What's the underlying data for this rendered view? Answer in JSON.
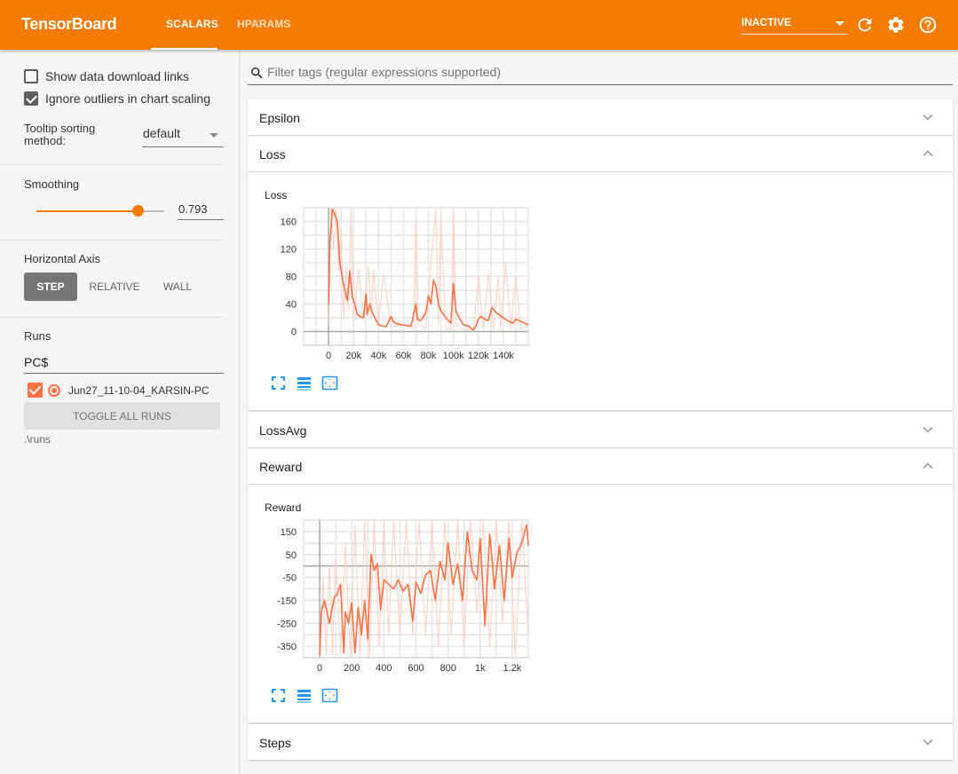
{
  "header": {
    "brand": "TensorBoard",
    "tabs": [
      {
        "label": "SCALARS",
        "active": true
      },
      {
        "label": "HPARAMS",
        "active": false
      }
    ],
    "run_status": "INACTIVE",
    "icons": [
      "refresh-icon",
      "settings-icon",
      "help-icon"
    ],
    "accent_color": "#f57c00"
  },
  "sidebar": {
    "show_download_links": {
      "label": "Show data download links",
      "checked": false
    },
    "ignore_outliers": {
      "label": "Ignore outliers in chart scaling",
      "checked": true
    },
    "tooltip_sorting": {
      "label": "Tooltip sorting method:",
      "value": "default"
    },
    "smoothing": {
      "label": "Smoothing",
      "value": "0.793",
      "fraction": 0.793
    },
    "horizontal_axis": {
      "label": "Horizontal Axis",
      "options": [
        "STEP",
        "RELATIVE",
        "WALL"
      ],
      "selected": "STEP"
    },
    "runs": {
      "label": "Runs",
      "filter_value": "PC$",
      "items": [
        {
          "name": "Jun27_11-10-04_KARSIN-PC",
          "checked": true,
          "color": "#ff7043"
        }
      ],
      "toggle_all_label": "TOGGLE ALL RUNS",
      "logdir": ".\\runs"
    }
  },
  "main": {
    "search_placeholder": "Filter tags (regular expressions supported)",
    "panes": [
      {
        "title": "Epsilon",
        "expanded": false
      },
      {
        "title": "Loss",
        "expanded": true
      },
      {
        "title": "LossAvg",
        "expanded": false
      },
      {
        "title": "Reward",
        "expanded": true
      },
      {
        "title": "Steps",
        "expanded": false
      }
    ],
    "chart_tool_icons": [
      "fit-to-screen-icon",
      "toggle-log-scale-icon",
      "fit-domain-icon"
    ]
  },
  "chart_data": [
    {
      "type": "line",
      "title": "Loss",
      "xlabel": "",
      "ylabel": "",
      "x_ticks": [
        "0",
        "20k",
        "40k",
        "60k",
        "80k",
        "100k",
        "120k",
        "140k"
      ],
      "y_ticks": [
        "0",
        "40",
        "80",
        "120",
        "160"
      ],
      "xlim": [
        -20000,
        160000
      ],
      "ylim": [
        -20,
        180
      ],
      "grid": true,
      "series": [
        {
          "name": "Jun27_11-10-04_KARSIN-PC (smoothed)",
          "x": [
            0,
            1000,
            2000,
            3000,
            5000,
            7000,
            9000,
            11000,
            13000,
            15000,
            17000,
            19000,
            21000,
            23000,
            25000,
            28000,
            30000,
            31000,
            33000,
            35000,
            37000,
            40000,
            43000,
            46000,
            50000,
            52000,
            54000,
            58000,
            62000,
            66000,
            70000,
            71000,
            74000,
            78000,
            80000,
            82000,
            84000,
            86000,
            88000,
            90000,
            94000,
            98000,
            100000,
            102000,
            104000,
            108000,
            112000,
            116000,
            118000,
            120000,
            122000,
            125000,
            128000,
            131000,
            134000,
            137000,
            140000,
            144000,
            148000,
            150000,
            154000,
            157000,
            160000
          ],
          "y": [
            40,
            130,
            150,
            178,
            170,
            160,
            100,
            78,
            60,
            45,
            88,
            50,
            40,
            25,
            22,
            20,
            55,
            25,
            40,
            28,
            20,
            10,
            8,
            7,
            22,
            14,
            12,
            10,
            9,
            8,
            40,
            18,
            16,
            28,
            52,
            40,
            75,
            65,
            40,
            30,
            20,
            12,
            70,
            30,
            22,
            10,
            8,
            2,
            8,
            18,
            22,
            18,
            16,
            35,
            28,
            24,
            20,
            15,
            12,
            18,
            15,
            12,
            10
          ]
        },
        {
          "name": "Jun27_11-10-04_KARSIN-PC (raw)",
          "x": [
            0,
            2000,
            4000,
            6000,
            8000,
            10000,
            12000,
            14000,
            16000,
            18000,
            20000,
            24000,
            28000,
            32000,
            34000,
            36000,
            40000,
            44000,
            50000,
            56000,
            62000,
            68000,
            70000,
            72000,
            78000,
            82000,
            86000,
            88000,
            90000,
            94000,
            98000,
            100000,
            102000,
            106000,
            110000,
            116000,
            120000,
            124000,
            128000,
            132000,
            136000,
            138000,
            142000,
            146000,
            150000,
            154000,
            158000,
            160000
          ],
          "y": [
            10,
            178,
            120,
            178,
            90,
            150,
            20,
            95,
            30,
            178,
            15,
            90,
            15,
            95,
            20,
            90,
            8,
            85,
            6,
            10,
            8,
            5,
            165,
            10,
            5,
            100,
            178,
            10,
            165,
            5,
            3,
            178,
            10,
            5,
            3,
            2,
            80,
            3,
            85,
            3,
            80,
            3,
            100,
            3,
            82,
            3,
            5,
            15
          ]
        }
      ]
    },
    {
      "type": "line",
      "title": "Reward",
      "xlabel": "",
      "ylabel": "",
      "x_ticks": [
        "0",
        "200",
        "400",
        "600",
        "800",
        "1k",
        "1.2k"
      ],
      "y_ticks": [
        "150",
        "50",
        "-50",
        "-150",
        "-250",
        "-350"
      ],
      "xlim": [
        -100,
        1300
      ],
      "ylim": [
        -400,
        200
      ],
      "grid": true,
      "series": [
        {
          "name": "Jun27_11-10-04_KARSIN-PC (smoothed)",
          "x": [
            0,
            10,
            30,
            60,
            90,
            110,
            130,
            150,
            160,
            180,
            200,
            220,
            240,
            260,
            280,
            300,
            320,
            340,
            360,
            380,
            400,
            430,
            460,
            490,
            520,
            550,
            580,
            600,
            630,
            660,
            690,
            720,
            750,
            780,
            800,
            830,
            860,
            890,
            920,
            950,
            980,
            1000,
            1030,
            1060,
            1090,
            1120,
            1150,
            1180,
            1200,
            1230,
            1260,
            1290,
            1300
          ],
          "y": [
            -390,
            -200,
            -150,
            -250,
            -140,
            -120,
            -80,
            -380,
            -200,
            -250,
            -160,
            -380,
            -180,
            -300,
            -150,
            -320,
            50,
            -20,
            10,
            -190,
            -60,
            -80,
            -100,
            -60,
            -110,
            -80,
            -240,
            -70,
            -120,
            -40,
            -20,
            -150,
            20,
            -60,
            100,
            -80,
            10,
            -150,
            150,
            -20,
            -60,
            120,
            -260,
            140,
            -100,
            90,
            -150,
            120,
            -50,
            60,
            100,
            180,
            90
          ]
        },
        {
          "name": "Jun27_11-10-04_KARSIN-PC (raw)",
          "x": [
            0,
            20,
            40,
            60,
            80,
            100,
            130,
            160,
            190,
            220,
            250,
            280,
            310,
            340,
            370,
            400,
            430,
            460,
            500,
            540,
            580,
            620,
            660,
            700,
            740,
            780,
            820,
            860,
            900,
            940,
            980,
            1020,
            1060,
            1100,
            1140,
            1180,
            1220,
            1260,
            1300
          ],
          "y": [
            -400,
            -50,
            -390,
            0,
            -390,
            40,
            -380,
            100,
            -400,
            180,
            -400,
            200,
            -400,
            200,
            -350,
            200,
            -300,
            200,
            -300,
            200,
            -300,
            200,
            -300,
            200,
            -350,
            200,
            -300,
            200,
            -350,
            200,
            -200,
            200,
            -350,
            200,
            -250,
            200,
            -400,
            200,
            -300
          ]
        }
      ]
    }
  ]
}
